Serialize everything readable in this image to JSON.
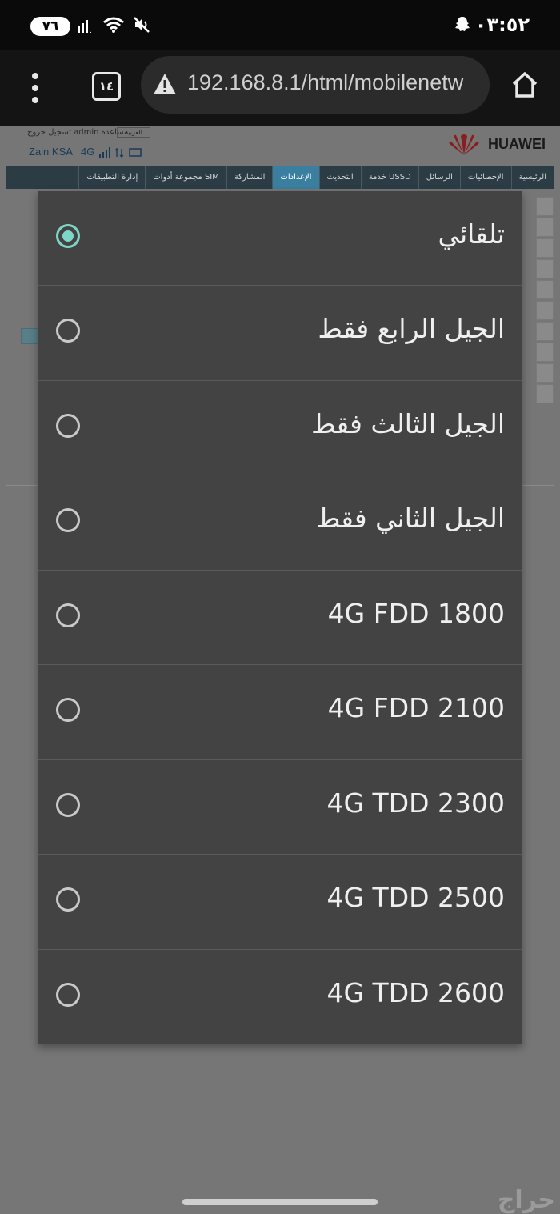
{
  "status_bar": {
    "battery": "٧٦",
    "time": "٠٣:٥٢"
  },
  "browser": {
    "tab_count": "١٤",
    "url": "192.168.8.1/html/mobilenetw"
  },
  "webpage": {
    "top_links": "تسجيل خروج   admin   مساعدة",
    "language": "العربية",
    "carrier": "Zain KSA",
    "network_type": "4G",
    "brand": "HUAWEI",
    "nav_items": [
      "الرئيسية",
      "الإحصائيات",
      "الرسائل",
      "خدمة USSD",
      "التحديث",
      "الإعدادات",
      "المشاركة",
      "مجموعة أدوات SIM",
      "إدارة التطبيقات"
    ],
    "active_nav": "الإعدادات"
  },
  "dialog": {
    "options": [
      {
        "label": "تلقائي",
        "selected": true
      },
      {
        "label": "الجيل الرابع فقط",
        "selected": false
      },
      {
        "label": "الجيل الثالث فقط",
        "selected": false
      },
      {
        "label": "الجيل الثاني فقط",
        "selected": false
      },
      {
        "label": "4G FDD 1800",
        "selected": false
      },
      {
        "label": "4G FDD 2100",
        "selected": false
      },
      {
        "label": "4G TDD 2300",
        "selected": false
      },
      {
        "label": "4G TDD 2500",
        "selected": false
      },
      {
        "label": "4G TDD 2600",
        "selected": false
      }
    ]
  },
  "watermark": "حراج",
  "colors": {
    "radio_selected": "#7fd6c8",
    "dialog_bg": "#434343"
  }
}
